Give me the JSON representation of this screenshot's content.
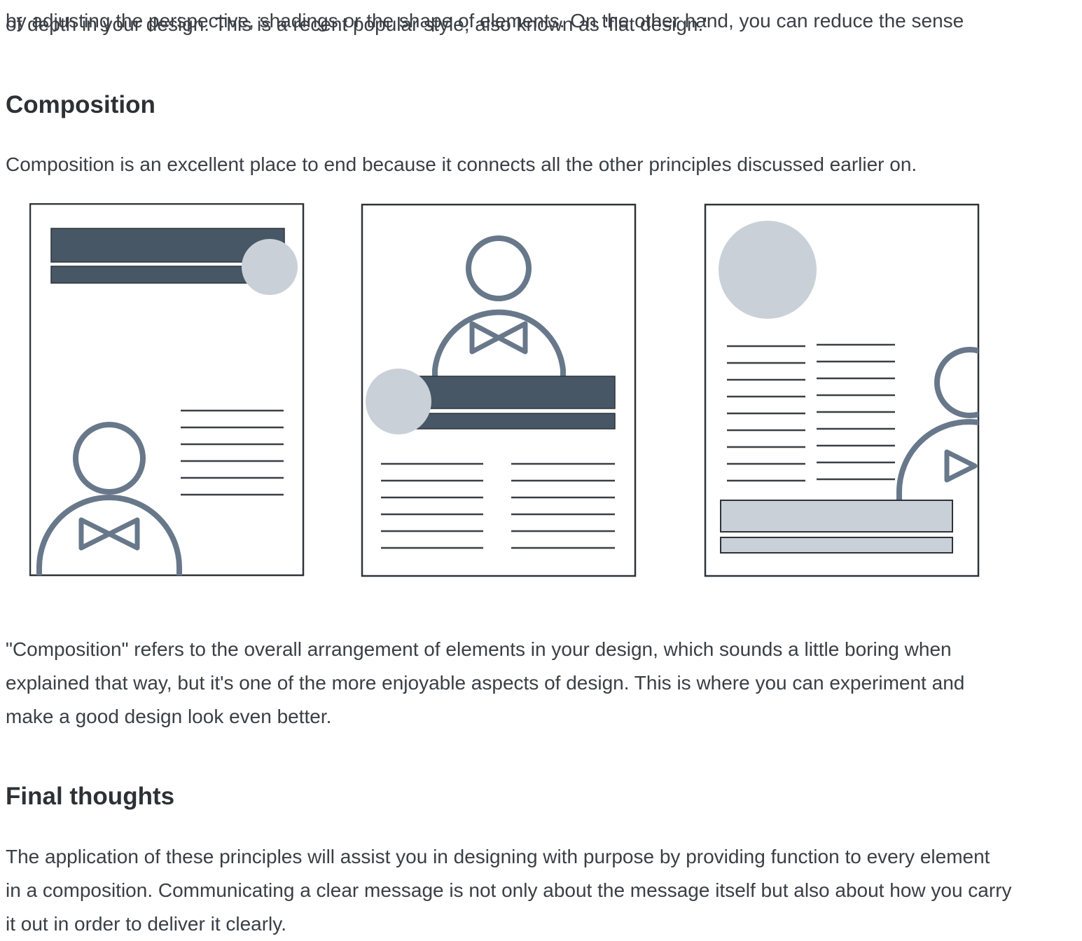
{
  "article": {
    "clipped_top_line": "by adjusting the perspective, shadings or the shape of elements. On the other hand, you can reduce the sense",
    "intro_end": "of depth in your design. This is a recent popular style, also known as 'flat design.'",
    "composition": {
      "heading": "Composition",
      "lead": "Composition is an excellent place to end because it connects all the other principles discussed earlier on.",
      "body_lines": [
        "\"Composition\" refers to the overall arrangement of elements in your design, which sounds a little boring when",
        "explained that way, but it's one of the more enjoyable aspects of design. This is where you can experiment and",
        "make a good design look even better."
      ]
    },
    "final": {
      "heading": "Final thoughts",
      "body_lines": [
        "The application of these principles will assist you in designing with purpose by providing function to every element",
        "in a composition. Communicating a clear message is not only about the message itself but also about how you carry",
        "it out in order to deliver it clearly."
      ]
    }
  },
  "colors": {
    "text": "#3a3f45",
    "heading": "#2d3136",
    "dark_slate": "#475766",
    "outline_slate": "#68788a",
    "light_gray": "#c9d0d8",
    "frame": "#2f3338"
  }
}
